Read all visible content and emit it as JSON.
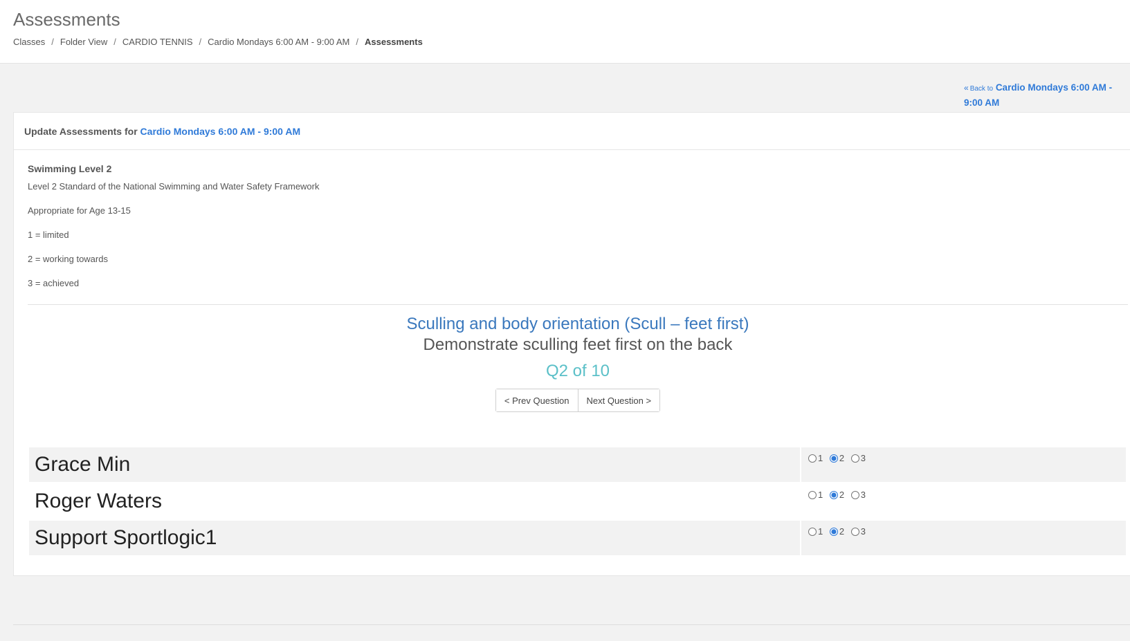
{
  "page": {
    "title": "Assessments",
    "breadcrumb": [
      "Classes",
      "Folder View",
      "CARDIO TENNIS",
      "Cardio Mondays 6:00 AM - 9:00 AM"
    ],
    "breadcrumb_current": "Assessments",
    "breadcrumb_separator": "/"
  },
  "back_link": {
    "prefix": "Back to",
    "target": "Cardio Mondays 6:00 AM - 9:00 AM"
  },
  "panel": {
    "heading_prefix": "Update Assessments for",
    "heading_class": "Cardio Mondays 6:00 AM - 9:00 AM"
  },
  "assessment": {
    "title": "Swimming Level 2",
    "lines": [
      "Level 2 Standard of the National Swimming and Water Safety Framework",
      "Appropriate for Age 13-15",
      "1 = limited",
      "2 = working towards",
      "3 = achieved"
    ]
  },
  "question": {
    "title": "Sculling and body orientation (Scull – feet first)",
    "description": "Demonstrate sculling feet first on the back",
    "counter": "Q2 of 10",
    "prev_label": "< Prev Question",
    "next_label": "Next Question >"
  },
  "grade_options": [
    "1",
    "2",
    "3"
  ],
  "students": [
    {
      "name": "Grace Min",
      "selected": "2"
    },
    {
      "name": "Roger Waters",
      "selected": "2"
    },
    {
      "name": "Support Sportlogic1",
      "selected": "2"
    }
  ],
  "colors": {
    "link": "#2f7ad8",
    "question_title": "#3a78bd",
    "counter": "#5bc0c8",
    "background": "#f2f2f2"
  }
}
